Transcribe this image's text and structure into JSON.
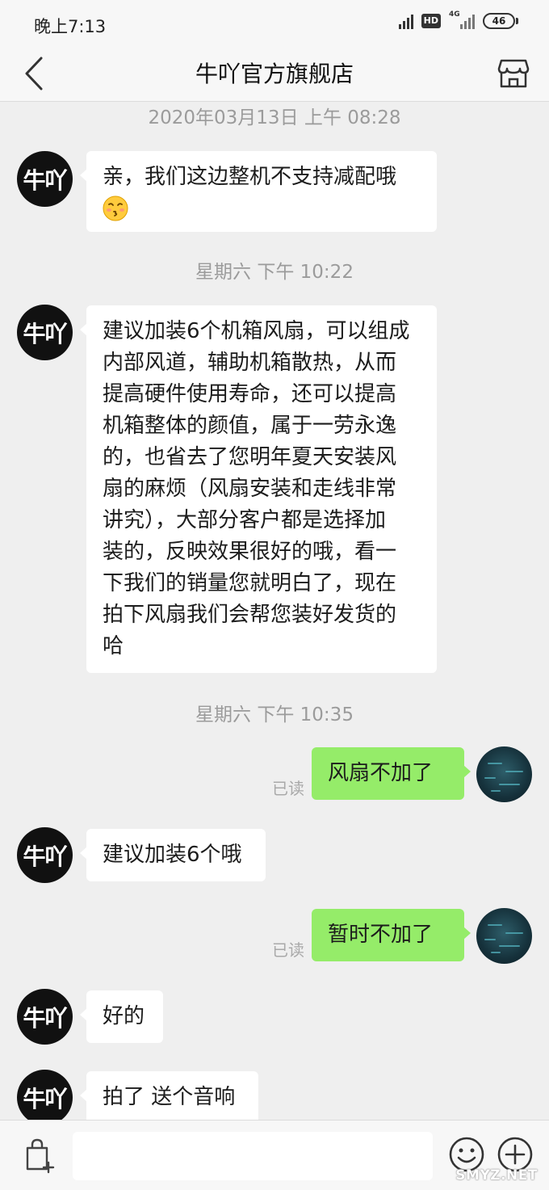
{
  "status_bar": {
    "time": "晚上7:13",
    "hd_label": "HD",
    "network": "4G",
    "battery": "46"
  },
  "header": {
    "title": "牛吖官方旗舰店"
  },
  "store_avatar_text": "牛吖",
  "messages": [
    {
      "type": "timestamp",
      "text": "2020年03月13日 上午 08:28"
    },
    {
      "type": "received",
      "text": "亲，我们这边整机不支持减配哦",
      "emoji": "kissing-face-emoji"
    },
    {
      "type": "timestamp",
      "text": "星期六 下午 10:22"
    },
    {
      "type": "received",
      "text": "建议加装6个机箱风扇，可以组成\n内部风道，辅助机箱散热，从而\n提高硬件使用寿命，还可以提高\n机箱整体的颜值，属于一劳永逸\n的，也省去了您明年夏天安装风\n扇的麻烦（风扇安装和走线非常\n讲究），大部分客户都是选择加\n装的，反映效果很好的哦，看一\n下我们的销量您就明白了，现在\n拍下风扇我们会帮您装好发货的\n哈"
    },
    {
      "type": "timestamp",
      "text": "星期六 下午 10:35"
    },
    {
      "type": "sent",
      "text": "风扇不加了",
      "status": "已读"
    },
    {
      "type": "received",
      "text": "建议加装6个哦"
    },
    {
      "type": "sent",
      "text": "暂时不加了",
      "status": "已读"
    },
    {
      "type": "received",
      "text": "好的"
    },
    {
      "type": "received",
      "text": "拍了 送个音响"
    }
  ],
  "input_bar": {
    "placeholder": ""
  },
  "watermark": "SMYZ.NET",
  "colors": {
    "sent_bubble": "#95ec69",
    "received_bubble": "#ffffff",
    "background": "#efefef",
    "timestamp_text": "#9b9b9b"
  },
  "icons": {
    "back": "chevron-left-icon",
    "store": "storefront-icon",
    "cart": "shopping-bag-add-icon",
    "emoji": "smiley-icon",
    "plus": "plus-circle-icon"
  }
}
